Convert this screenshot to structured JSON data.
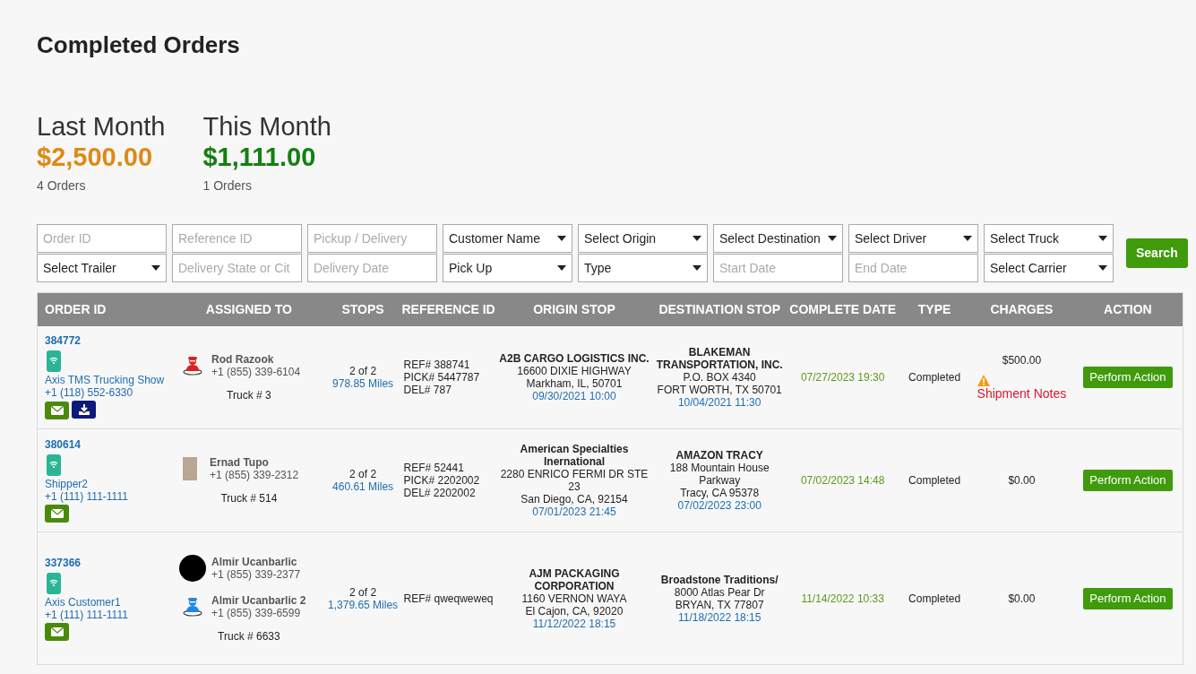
{
  "page": {
    "title": "Completed Orders"
  },
  "summary": [
    {
      "label": "Last Month",
      "amount": "$2,500.00",
      "count": "4 Orders",
      "color": "#dd8a17"
    },
    {
      "label": "This Month",
      "amount": "$1,111.00",
      "count": "1 Orders",
      "color": "#13800f"
    }
  ],
  "filters": [
    {
      "kind": "input",
      "placeholder": "Order ID"
    },
    {
      "kind": "input",
      "placeholder": "Reference ID"
    },
    {
      "kind": "input",
      "placeholder": "Pickup / Delivery"
    },
    {
      "kind": "select",
      "value": "Customer Name"
    },
    {
      "kind": "select",
      "value": "Select Origin"
    },
    {
      "kind": "select",
      "value": "Select Destination"
    },
    {
      "kind": "select",
      "value": "Select Driver"
    },
    {
      "kind": "select",
      "value": "Select Truck"
    },
    {
      "kind": "select",
      "value": "Select Trailer"
    },
    {
      "kind": "input",
      "placeholder": "Delivery State or Cit"
    },
    {
      "kind": "input",
      "placeholder": "Delivery Date"
    },
    {
      "kind": "select",
      "value": "Pick Up"
    },
    {
      "kind": "select",
      "value": "Type"
    },
    {
      "kind": "input",
      "placeholder": "Start Date"
    },
    {
      "kind": "input",
      "placeholder": "End Date"
    },
    {
      "kind": "select",
      "value": "Select Carrier"
    }
  ],
  "search_button": "Search",
  "table": {
    "columns": [
      "ORDER ID",
      "ASSIGNED TO",
      "STOPS",
      "REFERENCE ID",
      "ORIGIN STOP",
      "DESTINATION STOP",
      "COMPLETE DATE",
      "TYPE",
      "CHARGES",
      "ACTION"
    ],
    "rows": [
      {
        "order_id": "384772",
        "customer": {
          "name": "Axis TMS Trucking Show",
          "phone": "+1 (118) 552-6330"
        },
        "buttons": [
          {
            "kind": "email"
          },
          {
            "kind": "download"
          }
        ],
        "drivers": [
          {
            "kind": "icon",
            "color": "#e02020",
            "name": "Rod Razook",
            "phone": "+1 (855) 339-6104"
          }
        ],
        "truck": "Truck # 3",
        "stops": {
          "count": "2 of 2",
          "miles": "978.85 Miles"
        },
        "reference": [
          "REF# 388741",
          "PICK# 5447787",
          "DEL# 787"
        ],
        "origin": {
          "name": "A2B CARGO LOGISTICS INC.",
          "lines": [
            "16600 DIXIE HIGHWAY",
            "Markham, IL, 50701"
          ],
          "date": "09/30/2021 10:00"
        },
        "destination": {
          "name": "BLAKEMAN TRANSPORTATION, INC.",
          "lines": [
            "P.O. BOX 4340",
            "FORT WORTH, TX 50701"
          ],
          "date": "10/04/2021 11:30"
        },
        "complete_date": "07/27/2023 19:30",
        "type": "Completed",
        "charges": "$500.00",
        "notes": "Shipment Notes",
        "action": "Perform Action"
      },
      {
        "order_id": "380614",
        "customer": {
          "name": "Shipper2",
          "phone": "+1 (111) 111-1111"
        },
        "buttons": [
          {
            "kind": "email"
          }
        ],
        "drivers": [
          {
            "kind": "photo",
            "name": "Ernad Tupo",
            "phone": "+1 (855) 339-2312"
          }
        ],
        "truck": "Truck # 514",
        "stops": {
          "count": "2 of 2",
          "miles": "460.61 Miles"
        },
        "reference": [
          "REF# 52441",
          "PICK# 2202002",
          "DEL# 2202002"
        ],
        "origin": {
          "name": "American Specialties Inernational",
          "lines": [
            "2280 ENRICO FERMI DR STE 23",
            "San Diego, CA, 92154"
          ],
          "date": "07/01/2023 21:45"
        },
        "destination": {
          "name": "AMAZON TRACY",
          "lines": [
            "188 Mountain House Parkway",
            "Tracy, CA 95378"
          ],
          "date": "07/02/2023 23:00"
        },
        "complete_date": "07/02/2023 14:48",
        "type": "Completed",
        "charges": "$0.00",
        "action": "Perform Action"
      },
      {
        "order_id": "337366",
        "customer": {
          "name": "Axis Customer1",
          "phone": "+1 (111) 111-1111"
        },
        "buttons": [
          {
            "kind": "email"
          }
        ],
        "drivers": [
          {
            "kind": "blank",
            "name": "Almir Ucanbarlic",
            "phone": "+1 (855) 339-2377"
          },
          {
            "kind": "icon",
            "color": "#1e88e5",
            "name": "Almir Ucanbarlic 2",
            "phone": "+1 (855) 339-6599"
          }
        ],
        "truck": "Truck # 6633",
        "stops": {
          "count": "2 of 2",
          "miles": "1,379.65 Miles"
        },
        "reference": [
          "REF# qweqweweq"
        ],
        "origin": {
          "name": "AJM PACKAGING CORPORATION",
          "lines": [
            "1160 VERNON WAYA",
            "El Cajon, CA, 92020"
          ],
          "date": "11/12/2022 18:15"
        },
        "destination": {
          "name": "Broadstone Traditions/",
          "lines": [
            "8000 Atlas Pear Dr",
            "BRYAN, TX 77807"
          ],
          "date": "11/18/2022 18:15"
        },
        "complete_date": "11/14/2022 10:33",
        "type": "Completed",
        "charges": "$0.00",
        "action": "Perform Action"
      }
    ]
  }
}
